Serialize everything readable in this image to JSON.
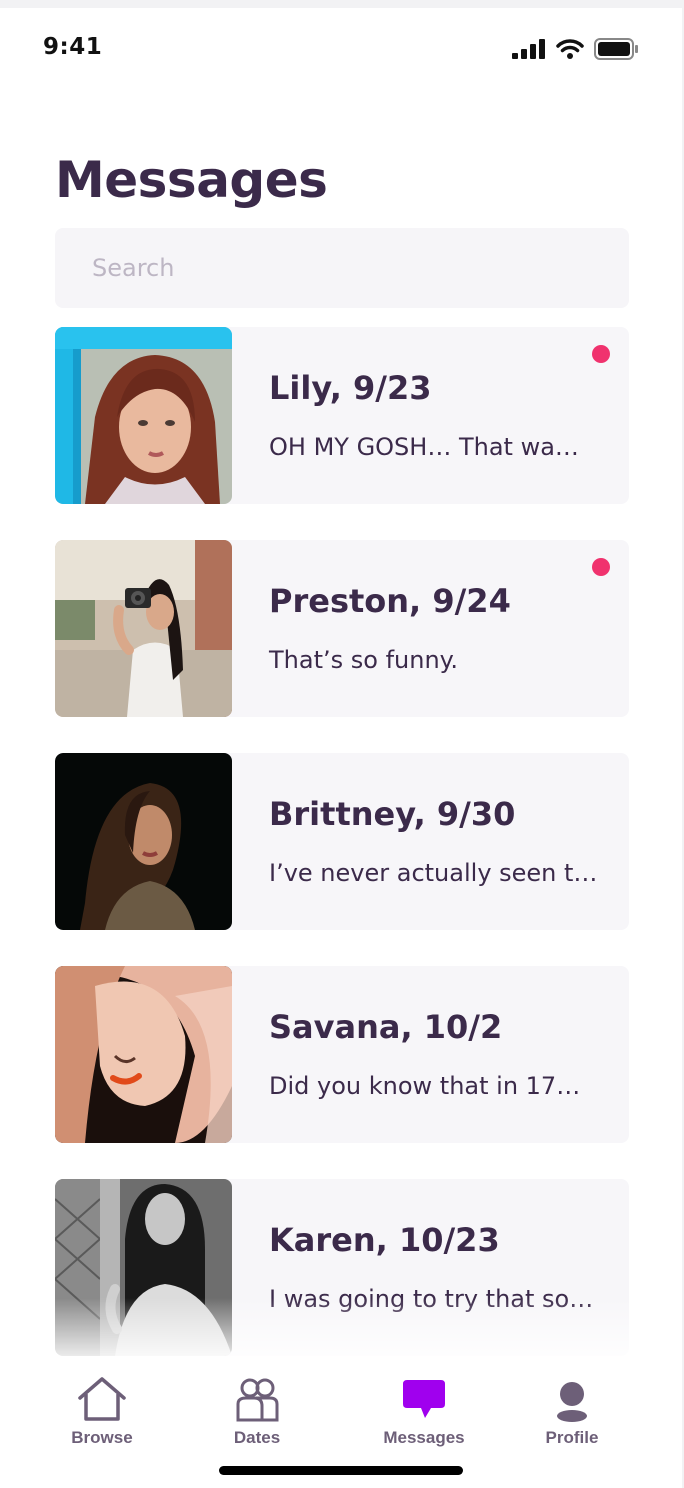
{
  "status_bar": {
    "time": "9:41"
  },
  "page": {
    "title": "Messages"
  },
  "search": {
    "placeholder": "Search",
    "value": ""
  },
  "conversations": [
    {
      "name": "Lily, 9/23",
      "preview": "OH MY GOSH… That wa…",
      "unread": true
    },
    {
      "name": "Preston, 9/24",
      "preview": "That’s so funny.",
      "unread": true
    },
    {
      "name": "Brittney, 9/30",
      "preview": "I’ve never actually seen t…",
      "unread": false
    },
    {
      "name": "Savana, 10/2",
      "preview": "Did you know that in 17…",
      "unread": false
    },
    {
      "name": "Karen, 10/23",
      "preview": "I was going to try that so…",
      "unread": false
    }
  ],
  "tabs": [
    {
      "label": "Browse",
      "icon": "home-icon",
      "active": false
    },
    {
      "label": "Dates",
      "icon": "people-icon",
      "active": false
    },
    {
      "label": "Messages",
      "icon": "chat-bubble-icon",
      "active": true
    },
    {
      "label": "Profile",
      "icon": "person-icon",
      "active": false
    }
  ],
  "colors": {
    "text": "#3b2a4a",
    "unread_dot": "#f0326e",
    "card_bg": "#f7f6f9",
    "active_tab_icon": "#a000ee",
    "inactive_tab": "#6d5f78"
  }
}
